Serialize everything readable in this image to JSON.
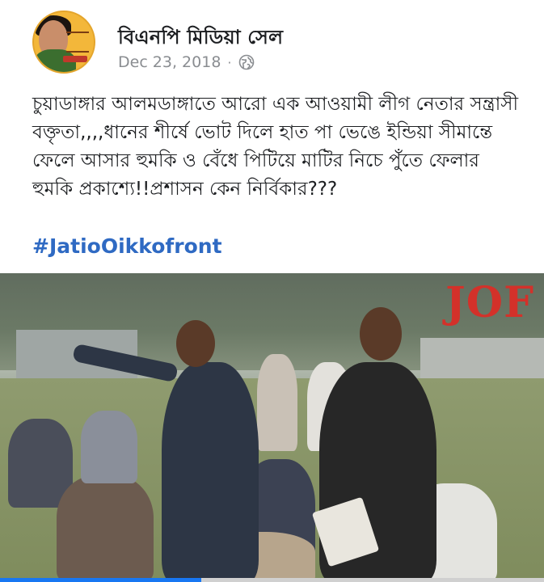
{
  "post": {
    "page_name": "বিএনপি মিডিয়া সেল",
    "date": "Dec 23, 2018",
    "separator": "·",
    "privacy_icon": "globe-icon",
    "text": "চুয়াডাঙ্গার আলমডাঙ্গাতে আরো এক আওয়ামী লীগ নেতার সন্ত্রাসী বক্তৃতা,,,,ধানের শীর্ষে ভোট দিলে হাত পা ভেঙে ইন্ডিয়া সীমান্তে ফেলে আসার হুমকি ও বেঁধে পিটিয়ে মাটির নিচে পুঁতে ফেলার হুমকি প্রকাশ্যে!!প্রশাসন কেন নির্বিকার???",
    "hashtag": "#JatioOikkofront"
  },
  "video": {
    "watermark": "JOF",
    "progress": 0.37,
    "accent_color": "#1877f2"
  }
}
